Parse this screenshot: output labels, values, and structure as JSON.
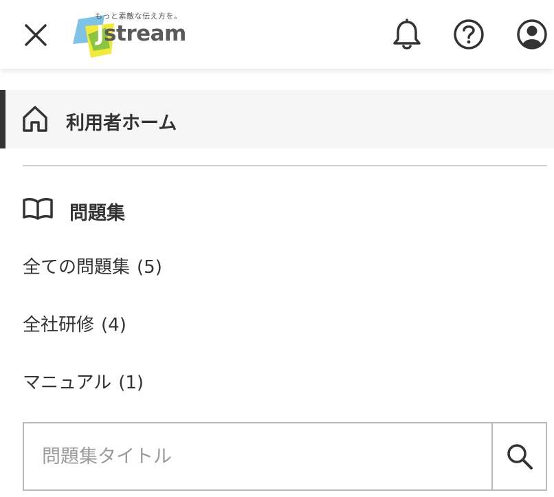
{
  "header": {
    "close_icon": "close-icon",
    "logo": {
      "tagline": "もっと素敵な伝え方を。",
      "brand_j": "J",
      "brand_rest": "stream"
    },
    "icons": [
      "bell-icon",
      "help-icon",
      "account-icon"
    ]
  },
  "nav": {
    "home": {
      "label": "利用者ホーム",
      "icon": "home-icon"
    },
    "section": {
      "label": "問題集",
      "icon": "book-icon"
    },
    "items": [
      {
        "label": "全ての問題集",
        "count": "(5)"
      },
      {
        "label": "全社研修",
        "count": "(4)"
      },
      {
        "label": "マニュアル",
        "count": "(1)"
      }
    ]
  },
  "search": {
    "placeholder": "問題集タイトル",
    "icon": "search-icon"
  },
  "colors": {
    "text": "#333333",
    "active_bg": "#f6f6f6",
    "active_bar": "#333333",
    "logo_blue": "#7ec3e6",
    "logo_yellow": "#f2ea3b",
    "logo_green": "#8cc63f"
  }
}
